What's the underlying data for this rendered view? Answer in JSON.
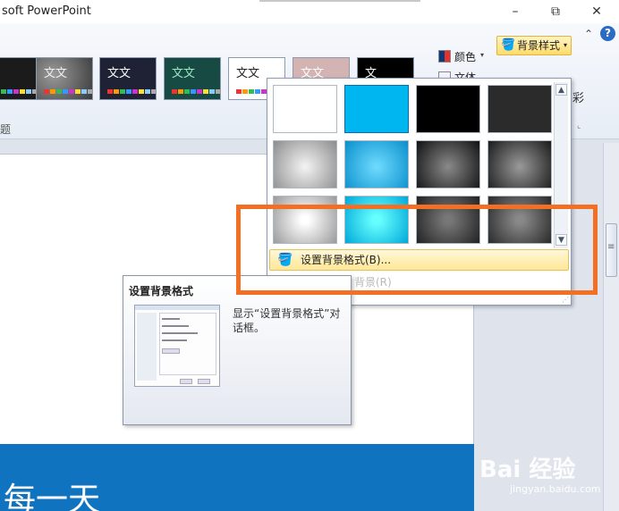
{
  "window": {
    "title": "soft PowerPoint",
    "minimize": "–",
    "maximize": "⧉",
    "close": "✕"
  },
  "ribbon": {
    "help_collapse": "⌃",
    "help_icon": "?",
    "group_label": "题",
    "themes": [
      {
        "text": "",
        "bg": "#1b1b1b",
        "fg": "#ffffff"
      },
      {
        "text": "文文",
        "bg": "#6b6b6b",
        "fg": "#f0f0f0"
      },
      {
        "text": "文文",
        "bg": "#1f2235",
        "fg": "#ffffff"
      },
      {
        "text": "文文",
        "bg": "#184a44",
        "fg": "#9ee8c8"
      },
      {
        "text": "文文",
        "bg": "#ffffff",
        "fg": "#222222"
      },
      {
        "text": "文文",
        "bg": "#d4b3b3",
        "fg": "#ffffff"
      },
      {
        "text": "文",
        "bg": "#000000",
        "fg": "#ffffff"
      }
    ],
    "colors_label": "颜色",
    "fonts_label": "文体",
    "background_styles_label": "背景样式",
    "side_glyph": "彩"
  },
  "gallery": {
    "swatches": [
      {
        "row": 1,
        "col": 1,
        "style": "white"
      },
      {
        "row": 1,
        "col": 2,
        "style": "cyan"
      },
      {
        "row": 1,
        "col": 3,
        "style": "black"
      },
      {
        "row": 1,
        "col": 4,
        "style": "dark-gray"
      },
      {
        "row": 2,
        "col": 1,
        "style": "gray-gradient"
      },
      {
        "row": 2,
        "col": 2,
        "style": "cyan-gradient"
      },
      {
        "row": 2,
        "col": 3,
        "style": "dark-radial"
      },
      {
        "row": 2,
        "col": 4,
        "style": "dark-radial-light"
      },
      {
        "row": 3,
        "col": 1,
        "style": "silver-radial"
      },
      {
        "row": 3,
        "col": 2,
        "style": "cyan-radial"
      },
      {
        "row": 3,
        "col": 3,
        "style": "charcoal-radial"
      },
      {
        "row": 3,
        "col": 4,
        "style": "charcoal-radial-light"
      }
    ],
    "format_background_item": "设置背景格式(B)...",
    "reset_background_item": "背景(R)"
  },
  "tooltip": {
    "title": "设置背景格式",
    "description": "显示“设置背景格式”对话框。"
  },
  "slide": {
    "visible_text": "每一天"
  },
  "watermark": {
    "brand": "Bai 经验",
    "url": "jingyan.baidu.com"
  },
  "colors": {
    "highlight": "#f26f24",
    "slide_band": "#0f73c0",
    "active_menu": "#ffe797"
  }
}
